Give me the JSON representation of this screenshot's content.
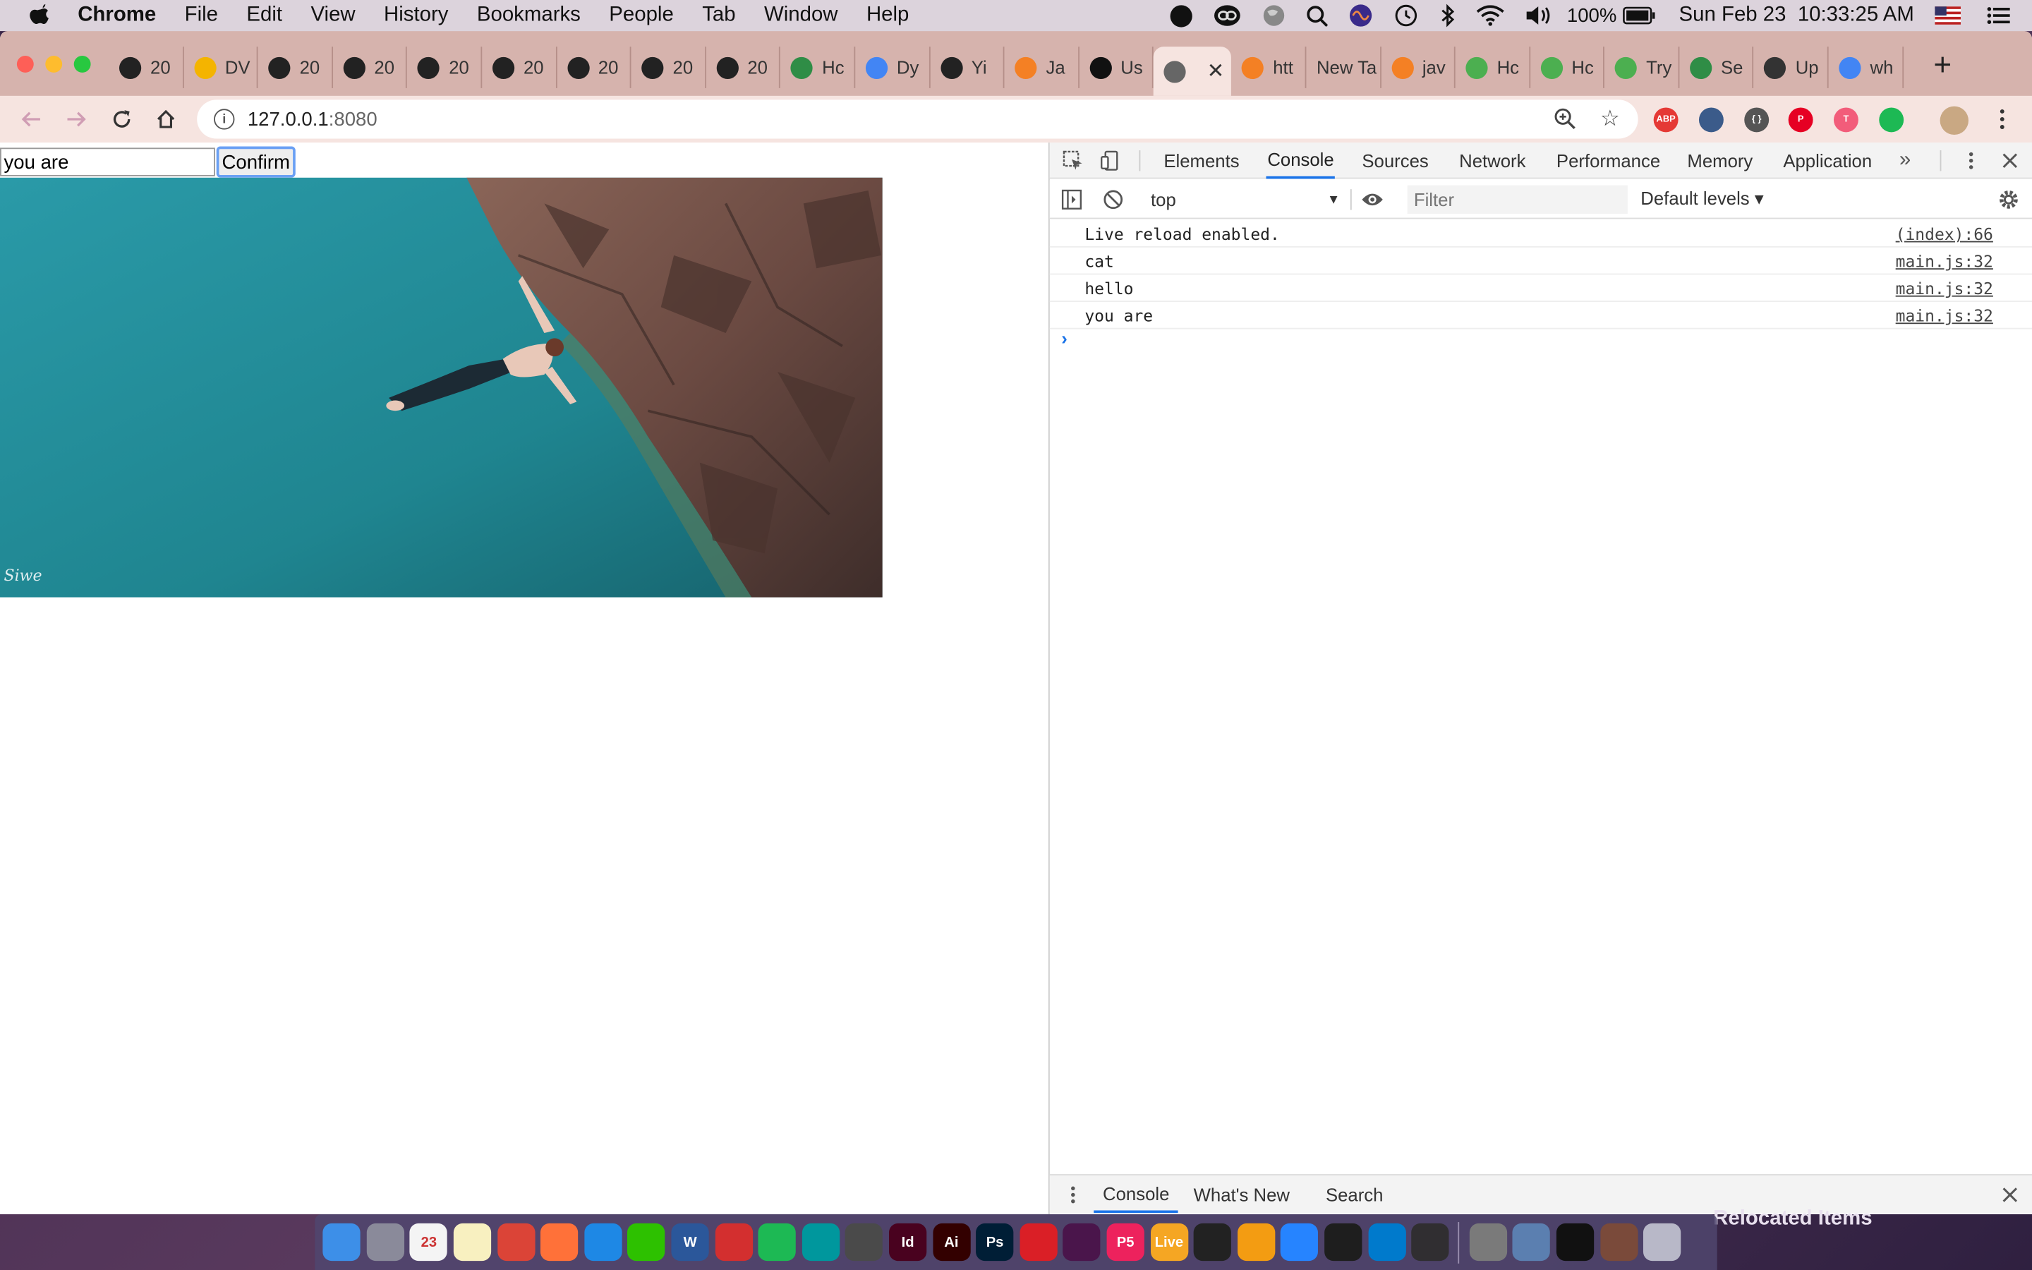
{
  "menubar": {
    "app": "Chrome",
    "items": [
      "File",
      "Edit",
      "View",
      "History",
      "Bookmarks",
      "People",
      "Tab",
      "Window",
      "Help"
    ],
    "battery": "100%",
    "datetime": "Sun Feb 23  10:33:25 AM"
  },
  "tabs": [
    {
      "label": "20",
      "icon": "github-icon",
      "color": "#222222"
    },
    {
      "label": "DV",
      "icon": "slides-icon",
      "color": "#f4b400"
    },
    {
      "label": "20",
      "icon": "github-icon",
      "color": "#222222"
    },
    {
      "label": "20",
      "icon": "github-icon",
      "color": "#222222"
    },
    {
      "label": "20",
      "icon": "github-icon",
      "color": "#222222"
    },
    {
      "label": "20",
      "icon": "github-icon",
      "color": "#222222"
    },
    {
      "label": "20",
      "icon": "github-icon",
      "color": "#222222"
    },
    {
      "label": "20",
      "icon": "github-icon",
      "color": "#222222"
    },
    {
      "label": "20",
      "icon": "github-icon",
      "color": "#222222"
    },
    {
      "label": "Hc",
      "icon": "geeks-icon",
      "color": "#2f8d46"
    },
    {
      "label": "Dy",
      "icon": "docs-icon",
      "color": "#4285f4"
    },
    {
      "label": "Yi",
      "icon": "github-icon",
      "color": "#222222"
    },
    {
      "label": "Ja",
      "icon": "stackoverflow-icon",
      "color": "#f48024"
    },
    {
      "label": "Us",
      "icon": "bulb-icon",
      "color": "#111111"
    },
    {
      "label": "",
      "icon": "globe-icon",
      "color": "#555555",
      "active": true
    },
    {
      "label": "htt",
      "icon": "stackoverflow-icon",
      "color": "#f48024"
    },
    {
      "label": "New Ta",
      "icon": "",
      "color": ""
    },
    {
      "label": "jav",
      "icon": "stackoverflow-icon",
      "color": "#f48024"
    },
    {
      "label": "Hc",
      "icon": "w3schools-icon",
      "color": "#4caf50"
    },
    {
      "label": "Hc",
      "icon": "w3schools-icon",
      "color": "#4caf50"
    },
    {
      "label": "Try",
      "icon": "w3schools-icon",
      "color": "#4caf50"
    },
    {
      "label": "Se",
      "icon": "geeks-icon",
      "color": "#2f8d46"
    },
    {
      "label": "Up",
      "icon": "anchor-icon",
      "color": "#333333"
    },
    {
      "label": "wh",
      "icon": "google-icon",
      "color": "#4285f4"
    }
  ],
  "address": {
    "host": "127.0.0.1",
    "port": ":8080"
  },
  "extensions": [
    {
      "name": "adblock-icon",
      "label": "ABP",
      "color": "#e53935"
    },
    {
      "name": "extension-2-icon",
      "label": "",
      "color": "#3b5b8a"
    },
    {
      "name": "code-icon",
      "label": "{ }",
      "color": "#555555"
    },
    {
      "name": "pinterest-icon",
      "label": "P",
      "color": "#e60023"
    },
    {
      "name": "extension-5-icon",
      "label": "T",
      "color": "#f25c7a"
    },
    {
      "name": "extension-6-icon",
      "label": "",
      "color": "#1db954"
    }
  ],
  "page": {
    "input_value": "you are",
    "button_label": "Confirm",
    "photo_watermark": "Siwe"
  },
  "devtools": {
    "tabs": [
      "Elements",
      "Console",
      "Sources",
      "Network",
      "Performance",
      "Memory",
      "Application"
    ],
    "active_tab": "Console",
    "context": "top",
    "filter_placeholder": "Filter",
    "levels": "Default levels ▾",
    "logs": [
      {
        "msg": "Live reload enabled.",
        "src": "(index):66"
      },
      {
        "msg": "cat",
        "src": "main.js:32"
      },
      {
        "msg": "hello",
        "src": "main.js:32"
      },
      {
        "msg": "you are",
        "src": "main.js:32"
      }
    ],
    "drawer_tabs": [
      "Console",
      "What's New",
      "Search"
    ]
  },
  "dock": {
    "apps": [
      {
        "name": "finder-icon",
        "label": "",
        "color": "#3d8fe8"
      },
      {
        "name": "launchpad-icon",
        "label": "",
        "color": "#8a8a9a"
      },
      {
        "name": "calendar-icon",
        "label": "23",
        "color": "#f4f4f4"
      },
      {
        "name": "notes-icon",
        "label": "",
        "color": "#f8f0c0"
      },
      {
        "name": "chrome-icon",
        "label": "",
        "color": "#db4437"
      },
      {
        "name": "firefox-icon",
        "label": "",
        "color": "#ff7139"
      },
      {
        "name": "safari-icon",
        "label": "",
        "color": "#1e88e5"
      },
      {
        "name": "wechat-icon",
        "label": "",
        "color": "#2dc100"
      },
      {
        "name": "word-icon",
        "label": "W",
        "color": "#2b579a"
      },
      {
        "name": "acrobat-icon",
        "label": "",
        "color": "#d32f2f"
      },
      {
        "name": "spotify-icon",
        "label": "",
        "color": "#1db954"
      },
      {
        "name": "arduino-icon",
        "label": "",
        "color": "#00979d"
      },
      {
        "name": "sublime-icon",
        "label": "",
        "color": "#4a4a4a"
      },
      {
        "name": "indesign-icon",
        "label": "Id",
        "color": "#49021f"
      },
      {
        "name": "illustrator-icon",
        "label": "Ai",
        "color": "#330000"
      },
      {
        "name": "photoshop-icon",
        "label": "Ps",
        "color": "#001e36"
      },
      {
        "name": "creative-cloud-icon",
        "label": "",
        "color": "#da1f26"
      },
      {
        "name": "slack-icon",
        "label": "",
        "color": "#4a154b"
      },
      {
        "name": "p5-icon",
        "label": "P5",
        "color": "#ed225d"
      },
      {
        "name": "live-icon",
        "label": "Live",
        "color": "#f5a623"
      },
      {
        "name": "terminal-app-icon",
        "label": "",
        "color": "#222222"
      },
      {
        "name": "books-icon",
        "label": "",
        "color": "#f39c12"
      },
      {
        "name": "sourcetree-icon",
        "label": "",
        "color": "#2684ff"
      },
      {
        "name": "figma-icon",
        "label": "",
        "color": "#1e1e1e"
      },
      {
        "name": "vscode-icon",
        "label": "",
        "color": "#007acc"
      },
      {
        "name": "obs-icon",
        "label": "",
        "color": "#302e31"
      }
    ],
    "right_apps": [
      {
        "name": "system-preferences-icon",
        "label": "",
        "color": "#7a7a7a"
      },
      {
        "name": "preview-icon",
        "label": "",
        "color": "#5b7fb0"
      },
      {
        "name": "terminal-icon",
        "label": "",
        "color": "#111111"
      }
    ],
    "relocated": "Relocated Items"
  }
}
